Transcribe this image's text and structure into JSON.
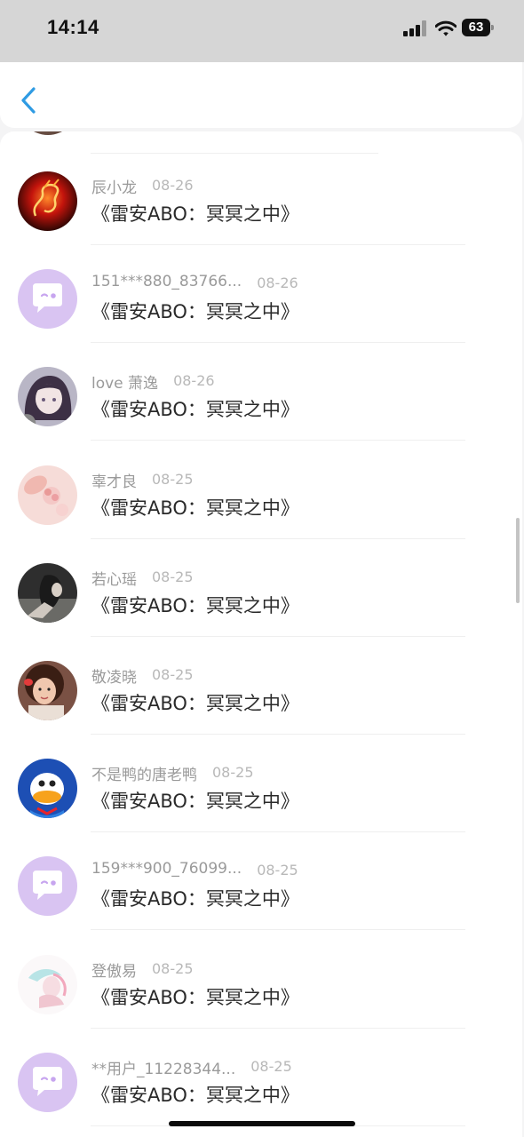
{
  "status_bar": {
    "time": "14:14",
    "battery": "63"
  },
  "colors": {
    "accent": "#2f9be3",
    "default_avatar_bg": "#d9c4f2",
    "default_avatar_bubble": "#ffffff",
    "default_avatar_face": "#c7a5ef"
  },
  "nav": {
    "back_icon": "chevron-left-icon"
  },
  "list": [
    {
      "name": "辰小龙",
      "date": "08-26",
      "title": "《雷安ABO：冥冥之中》",
      "avatar": "red-dragon-avatar"
    },
    {
      "name": "151***880_83766...",
      "date": "08-26",
      "title": "《雷安ABO：冥冥之中》",
      "avatar": "default-chat-bubble-avatar"
    },
    {
      "name": "love 萧逸",
      "date": "08-26",
      "title": "《雷安ABO：冥冥之中》",
      "avatar": "anime-girl-avatar"
    },
    {
      "name": "辜才良",
      "date": "08-25",
      "title": "《雷安ABO：冥冥之中》",
      "avatar": "pink-flower-avatar"
    },
    {
      "name": "若心瑶",
      "date": "08-25",
      "title": "《雷安ABO：冥冥之中》",
      "avatar": "dark-portrait-avatar"
    },
    {
      "name": "敬凌晓",
      "date": "08-25",
      "title": "《雷安ABO：冥冥之中》",
      "avatar": "girl-photo-avatar"
    },
    {
      "name": "不是鸭的唐老鸭",
      "date": "08-25",
      "title": "《雷安ABO：冥冥之中》",
      "avatar": "donald-duck-avatar"
    },
    {
      "name": "159***900_76099...",
      "date": "08-25",
      "title": "《雷安ABO：冥冥之中》",
      "avatar": "default-chat-bubble-avatar"
    },
    {
      "name": "登傲易",
      "date": "08-25",
      "title": "《雷安ABO：冥冥之中》",
      "avatar": "pastel-drawing-avatar"
    },
    {
      "name": "**用户_11228344...",
      "date": "08-25",
      "title": "《雷安ABO：冥冥之中》",
      "avatar": "default-chat-bubble-avatar"
    }
  ]
}
